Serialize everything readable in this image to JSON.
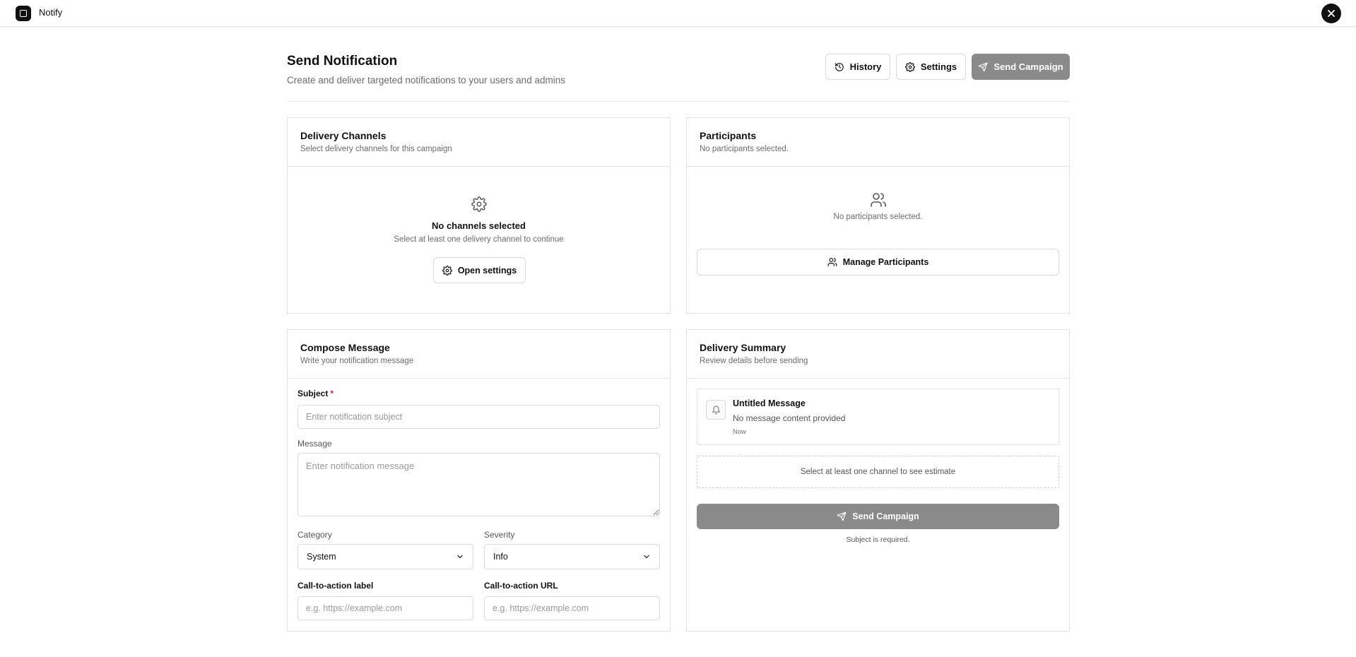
{
  "app": {
    "title": "Notify",
    "logo_icon": "square-logo-icon",
    "close_icon": "close-icon"
  },
  "header": {
    "title": "Send Notification",
    "subtitle": "Create and deliver targeted notifications to your users and admins",
    "buttons": {
      "history": {
        "label": "History",
        "icon": "history-icon"
      },
      "settings": {
        "label": "Settings",
        "icon": "gear-icon"
      },
      "send": {
        "label": "Send Campaign",
        "icon": "send-icon"
      }
    }
  },
  "channels": {
    "title": "Delivery Channels",
    "subtitle": "Select delivery channels for this campaign",
    "empty_icon": "gear-icon",
    "empty_title": "No channels selected",
    "empty_subtitle": "Select at least one delivery channel to continue",
    "open_settings_label": "Open settings"
  },
  "participants": {
    "title": "Participants",
    "subtitle": "No participants selected.",
    "empty_icon": "users-icon",
    "empty_text": "No participants selected.",
    "manage_label": "Manage Participants"
  },
  "compose": {
    "title": "Compose Message",
    "subtitle": "Write your notification message",
    "subject_label": "Subject",
    "subject_required_mark": "*",
    "subject_placeholder": "Enter notification subject",
    "subject_value": "",
    "message_label": "Message",
    "message_placeholder": "Enter notification message",
    "message_value": "",
    "category_label": "Category",
    "category_value": "System",
    "severity_label": "Severity",
    "severity_value": "Info",
    "cta_label_label": "Call-to-action label",
    "cta_label_placeholder": "e.g. https://example.com",
    "cta_url_label": "Call-to-action URL",
    "cta_url_placeholder": "e.g. https://example.com"
  },
  "summary": {
    "title": "Delivery Summary",
    "subtitle": "Review details before sending",
    "preview": {
      "icon": "bell-icon",
      "title": "Untitled Message",
      "body": "No message content provided",
      "time": "Now"
    },
    "estimate_text": "Select at least one channel to see estimate",
    "send_label": "Send Campaign",
    "send_icon": "send-icon",
    "validation_text": "Subject is required."
  },
  "colors": {
    "accent_dark": "#111111",
    "disabled_button": "#8a8a8a",
    "required": "#e11d48",
    "border": "#e3e3e3",
    "muted_text": "#6b6b6b"
  }
}
